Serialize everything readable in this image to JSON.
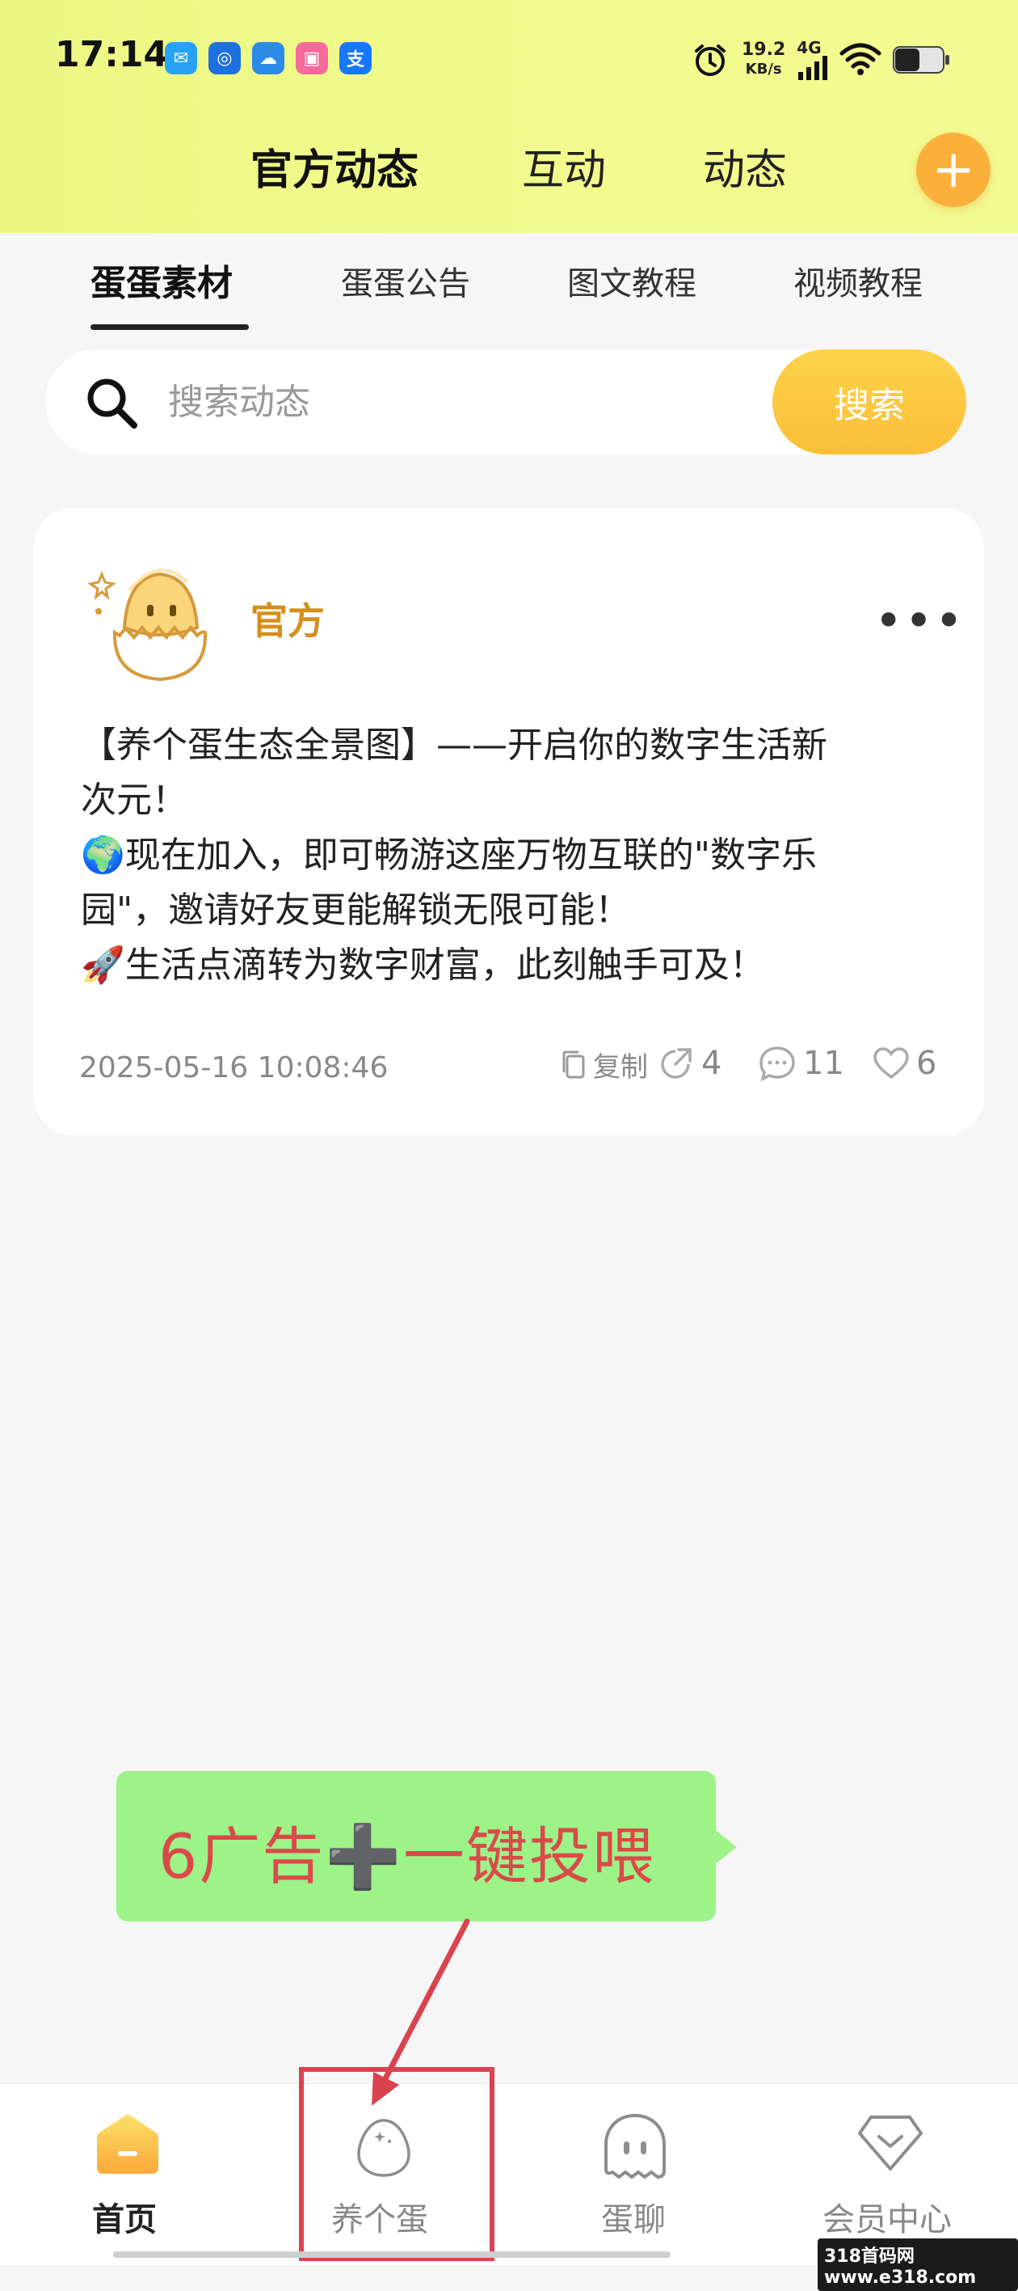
{
  "status_bar": {
    "time": "17:14",
    "network_speed": "19.2",
    "network_unit": "KB/s",
    "network_type": "4G"
  },
  "top_tabs": [
    {
      "label": "官方动态",
      "active": true
    },
    {
      "label": "互动",
      "active": false
    },
    {
      "label": "动态",
      "active": false
    }
  ],
  "add_button_label": "+",
  "sub_tabs": [
    {
      "label": "蛋蛋素材",
      "active": true
    },
    {
      "label": "蛋蛋公告",
      "active": false
    },
    {
      "label": "图文教程",
      "active": false
    },
    {
      "label": "视频教程",
      "active": false
    }
  ],
  "search": {
    "placeholder": "搜索动态",
    "button_label": "搜索"
  },
  "post": {
    "author": "官方",
    "lines": [
      "【养个蛋生态全景图】——开启你的数字生活新",
      "次元！",
      "🌍现在加入，即可畅游这座万物互联的\"数字乐",
      "园\"，邀请好友更能解锁无限可能！",
      "🚀生活点滴转为数字财富，此刻触手可及！"
    ],
    "timestamp": "2025-05-16 10:08:46",
    "copy_label": "复制",
    "share_count": "4",
    "comment_count": "11",
    "like_count": "6"
  },
  "promo_overlay": {
    "text": "6广告➕一键投喂"
  },
  "bottom_nav": [
    {
      "label": "首页",
      "active": true
    },
    {
      "label": "养个蛋",
      "active": false
    },
    {
      "label": "蛋聊",
      "active": false
    },
    {
      "label": "会员中心",
      "active": false
    }
  ],
  "watermark": "318首码网 www.e318.com",
  "colors": {
    "accent": "#fbb03b",
    "header": "#f1fa8c",
    "author": "#d58f1d",
    "promo_bg": "#9df388",
    "annotation_red": "#d8434f"
  }
}
